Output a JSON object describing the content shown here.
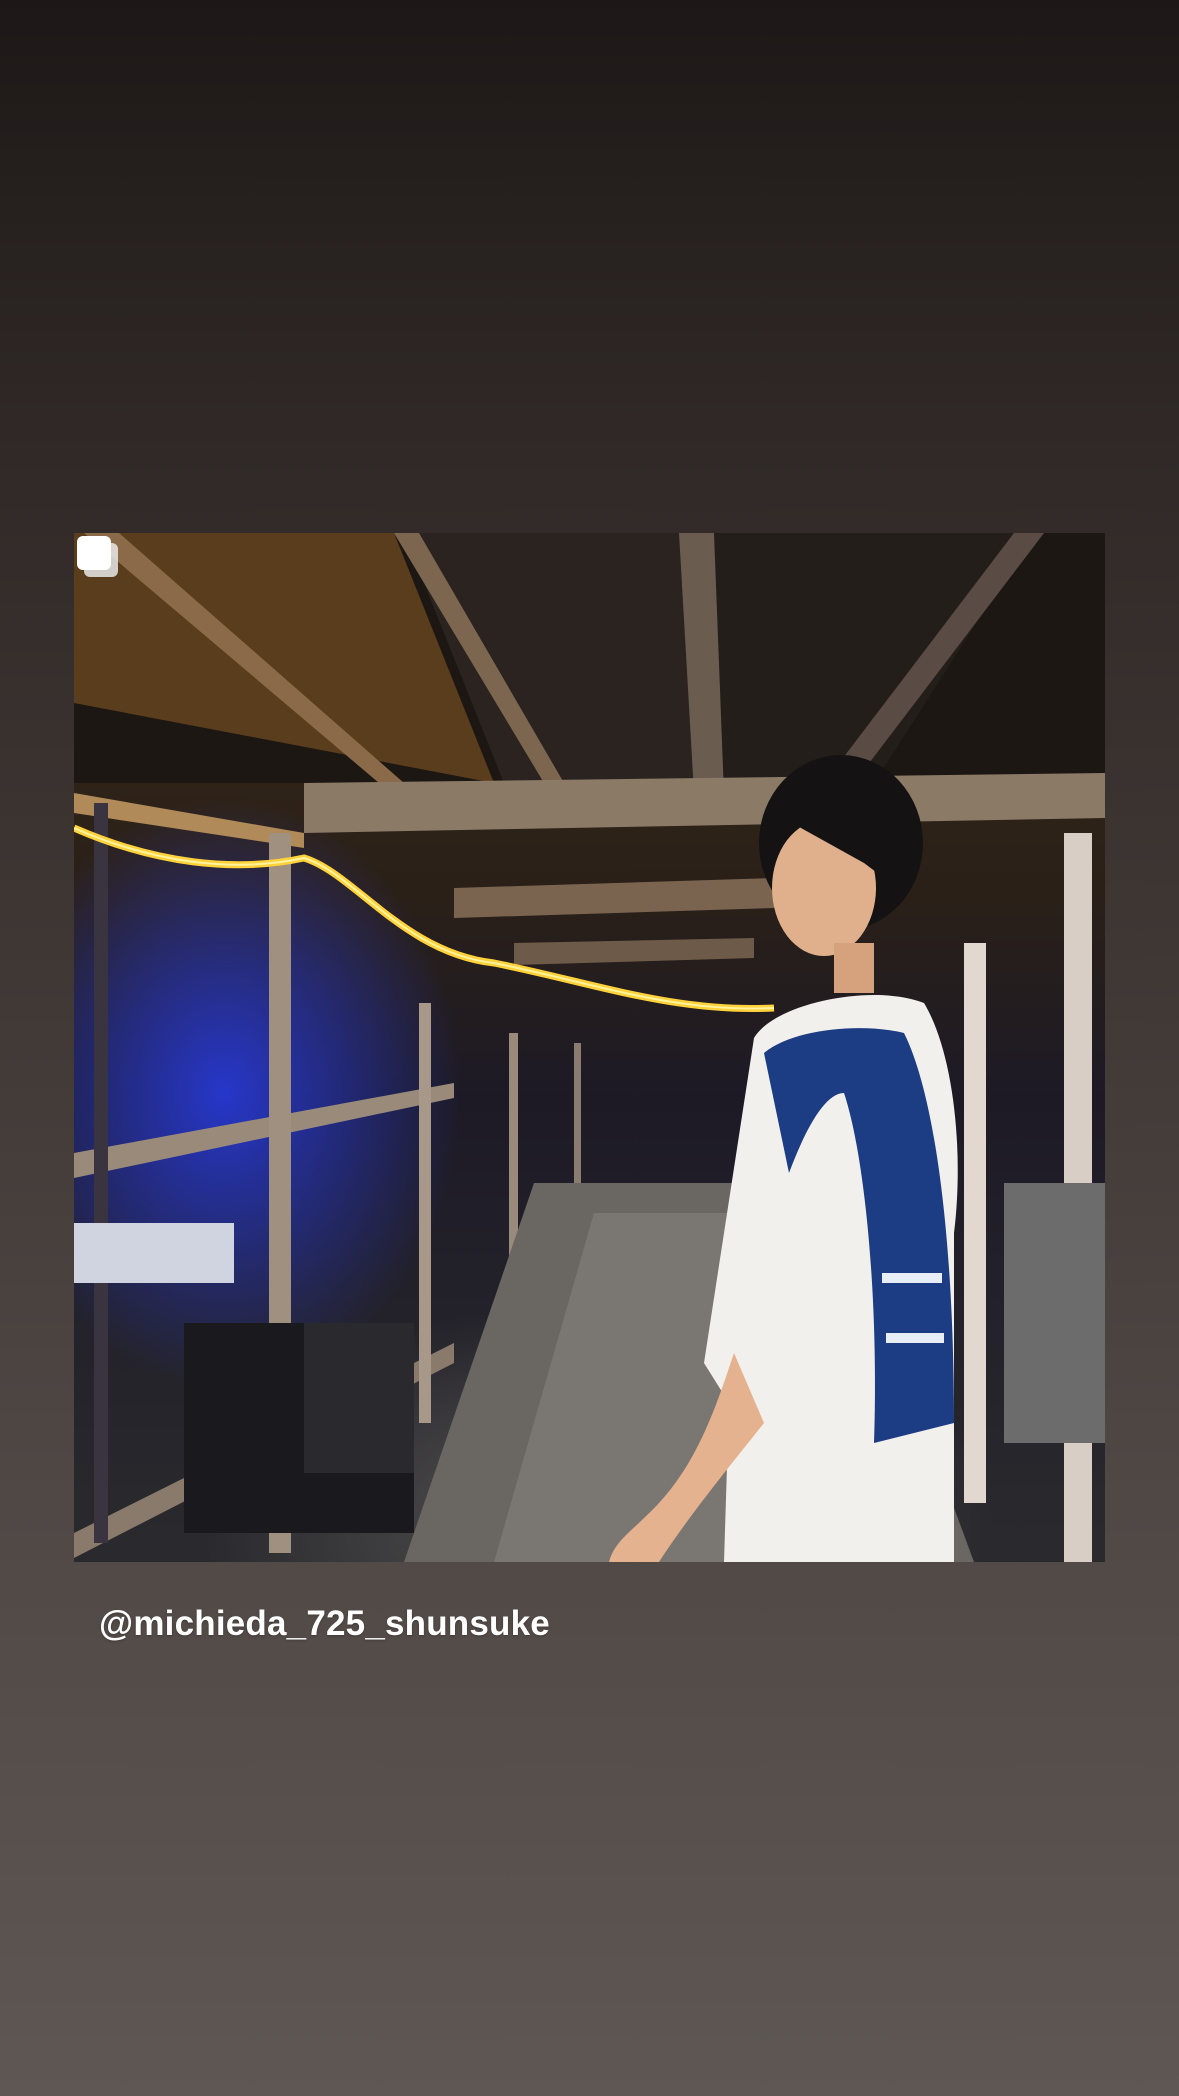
{
  "story": {
    "post": {
      "image_alt": "Photo of a person backstage under scaffolding with yellow string lights",
      "multi_photo_icon": "multiple-photos-icon"
    },
    "mention": "@michieda_725_shunsuke"
  }
}
